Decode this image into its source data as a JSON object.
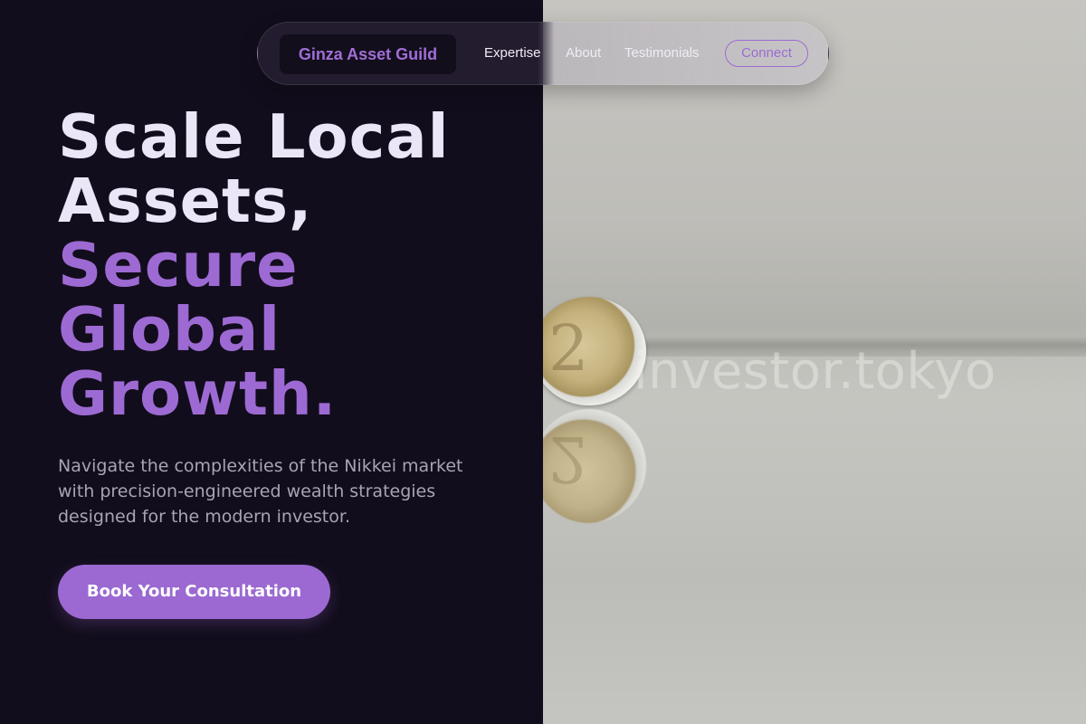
{
  "nav": {
    "brand": "Ginza Asset Guild",
    "links": [
      "Expertise",
      "About",
      "Testimonials"
    ],
    "connect_label": "Connect"
  },
  "hero": {
    "headline_white": [
      "Scale Local",
      "Assets,"
    ],
    "headline_purple": [
      "Secure",
      "Global",
      "Growth."
    ],
    "subtext": "Navigate the complexities of the Nikkei market with precision-engineered wealth strategies designed for the modern investor.",
    "cta_label": "Book Your Consultation"
  },
  "image": {
    "watermark": "investor.tokyo",
    "coin_glyph": "2"
  },
  "colors": {
    "background": "#120d1c",
    "accent": "#9b69d1",
    "headline_white": "#ebe6f7",
    "subtext": "#a9a3b4"
  }
}
